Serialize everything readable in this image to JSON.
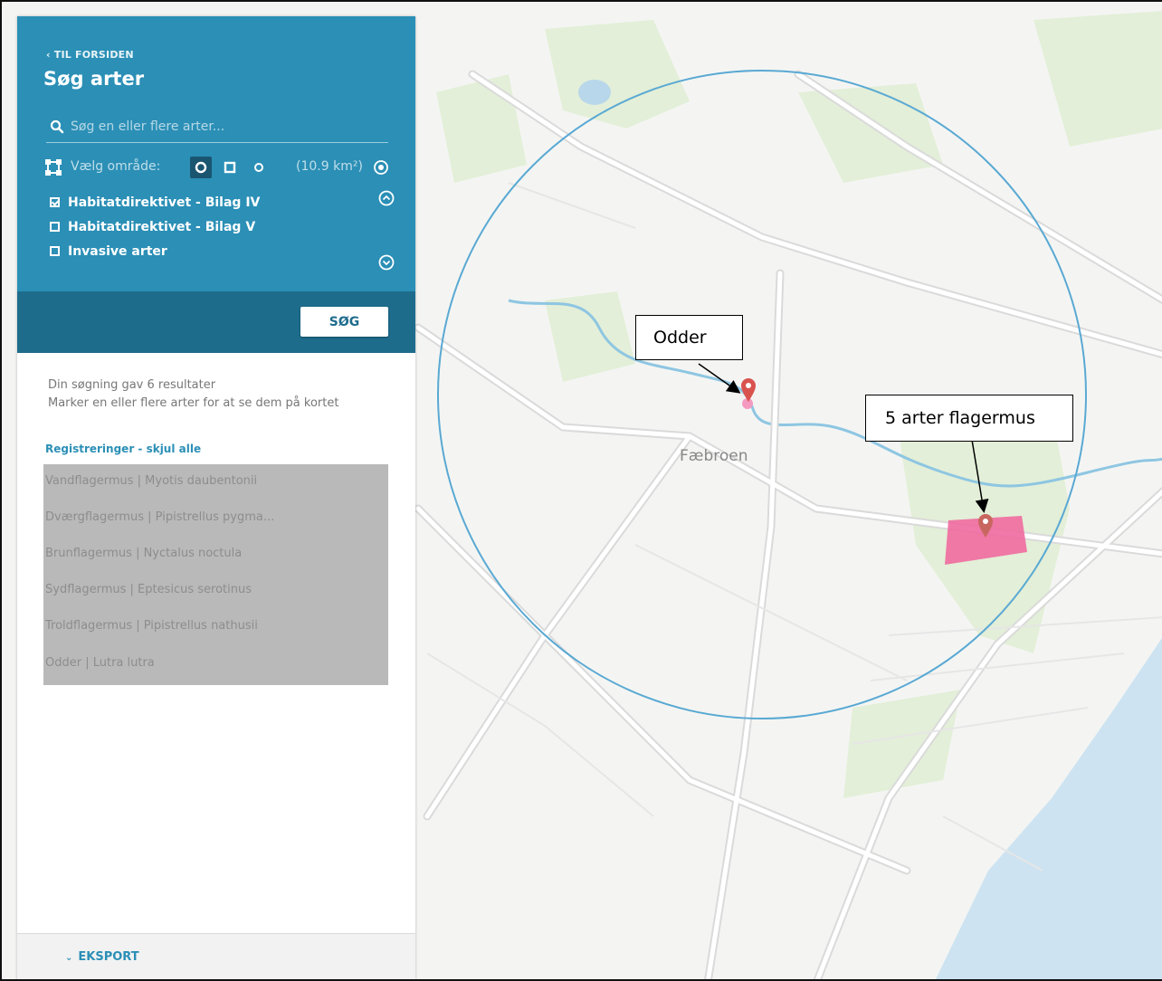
{
  "sidebar": {
    "back_link": "‹ TIL FORSIDEN",
    "title": "Søg arter",
    "search_placeholder": "Søg en eller flere arter...",
    "area_label": "Vælg område:",
    "area_size": "(10.9 km²)",
    "area_shapes": [
      "circle",
      "square",
      "point"
    ],
    "active_shape": "circle",
    "filters": [
      {
        "label": "Habitatdirektivet - Bilag IV",
        "checked": true
      },
      {
        "label": "Habitatdirektivet - Bilag V",
        "checked": false
      },
      {
        "label": "Invasive arter",
        "checked": false
      }
    ],
    "search_button": "SØG",
    "result_count": "Din søgning gav 6 resultater",
    "result_hint": "Marker en eller flere arter for at se dem på kortet",
    "registrations_header": "Registreringer - skjul alle",
    "registrations": [
      "Vandflagermus | Myotis daubentonii",
      "Dværgflagermus | Pipistrellus pygma...",
      "Brunflagermus | Nyctalus noctula",
      "Sydflagermus | Eptesicus serotinus",
      "Troldflagermus | Pipistrellus nathusii",
      "Odder | Lutra lutra"
    ],
    "export_label": "EKSPORT"
  },
  "map": {
    "place_label": "Fæbroen",
    "callouts": [
      "Odder",
      "5 arter flagermus"
    ],
    "colors": {
      "search_circle": "#5aa9d3",
      "marker": "#d9534f",
      "polygon": "#f06aa0",
      "water": "#cde3f1",
      "green": "#e3efd8"
    }
  },
  "colors": {
    "header_blue": "#2b8fb6",
    "header_dark": "#1e6c8c",
    "accent": "#2b8fb6"
  }
}
